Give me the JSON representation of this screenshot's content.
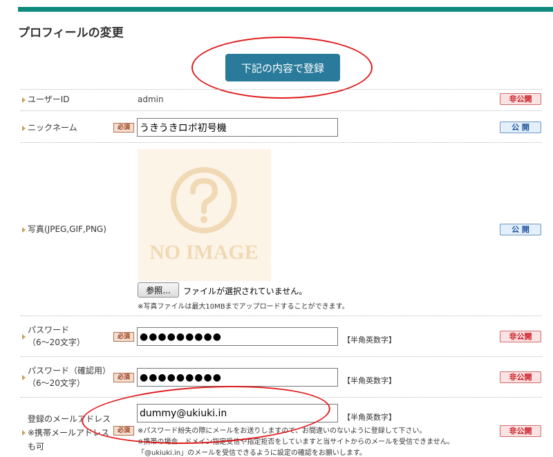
{
  "page": {
    "title": "プロフィールの変更"
  },
  "actions": {
    "submit_label": "下記の内容で登録"
  },
  "required_label": "必須",
  "fields": {
    "user_id": {
      "label": "ユーザーID",
      "value": "admin",
      "visibility": "非公開"
    },
    "nickname": {
      "label": "ニックネーム",
      "value": "うきうきロボ初号機",
      "visibility": "公 開"
    },
    "photo": {
      "label": "写真(JPEG,GIF,PNG)",
      "placeholder_text": "NO IMAGE",
      "browse_label": "参照...",
      "file_status": "ファイルが選択されていません。",
      "note": "※写真ファイルは最大10MBまでアップロードすることができます。",
      "visibility": "公 開"
    },
    "password": {
      "label_line1": "パスワード",
      "label_line2": "（6〜20文字）",
      "value": "●●●●●●●●●",
      "hint": "【半角英数字】",
      "visibility": "非公開"
    },
    "password_confirm": {
      "label_line1": "パスワード（確認用）",
      "label_line2": "（6〜20文字）",
      "value": "●●●●●●●●●",
      "hint": "【半角英数字】",
      "visibility": "非公開"
    },
    "email": {
      "label_line1": "登録のメールアドレス",
      "label_line2": "※携帯メールアドレス",
      "label_line3": "も可",
      "value": "dummy@ukiuki.in",
      "hint": "【半角英数字】",
      "note_line1": "※パスワード紛失の際にメールをお送りしますので、お間違いのないように登録して下さい。",
      "note_line2": "※携帯の場合、ドメイン指定受信や指定拒否をしていますと当サイトからのメールを受信できません。",
      "note_line3": "「@ukiuki.in」のメールを受信できるように設定の確認をお願いします。",
      "visibility": "非公開"
    }
  },
  "colors": {
    "accent_bar": "#0e8a7c",
    "submit_button": "#2a7b9b",
    "annotation_ellipse": "#e0191b"
  }
}
